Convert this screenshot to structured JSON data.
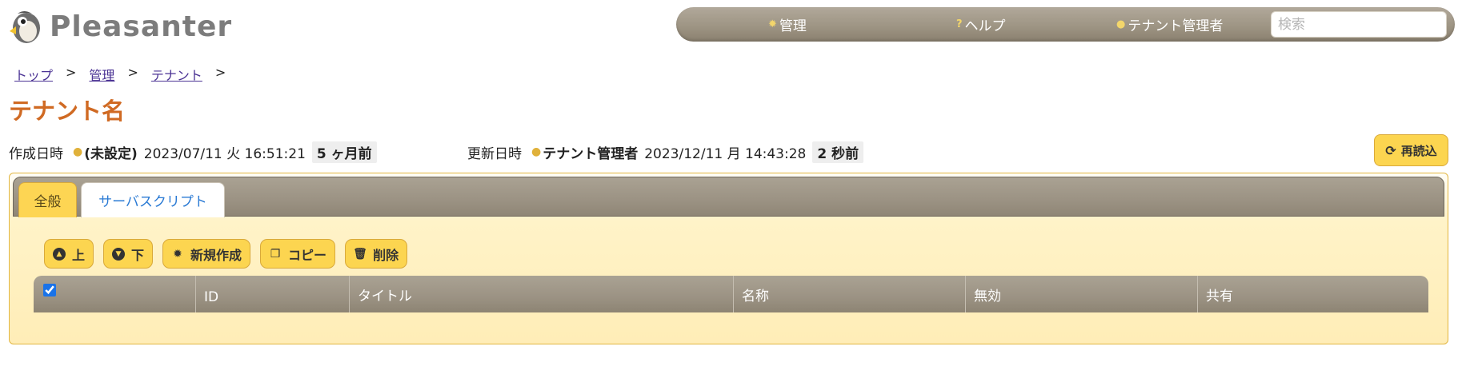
{
  "header": {
    "logo_text": "Pleasanter",
    "nav": {
      "manage": "管理",
      "help": "ヘルプ",
      "user": "テナント管理者"
    },
    "search_placeholder": "検索"
  },
  "breadcrumb": {
    "items": [
      "トップ",
      "管理",
      "テナント"
    ],
    "separator": ">"
  },
  "page_title": "テナント名",
  "record_info": {
    "created_label": "作成日時",
    "created_by": "(未設定)",
    "created_at": "2023/07/11 火 16:51:21",
    "created_relative": "5 ヶ月前",
    "updated_label": "更新日時",
    "updated_by": "テナント管理者",
    "updated_at": "2023/12/11 月 14:43:28",
    "updated_relative": "2 秒前"
  },
  "reload_label": "再読込",
  "tabs": {
    "general": "全般",
    "server_script": "サーバスクリプト"
  },
  "toolbar": {
    "up": "上",
    "down": "下",
    "new": "新規作成",
    "copy": "コピー",
    "delete": "削除"
  },
  "grid": {
    "columns": [
      "ID",
      "タイトル",
      "名称",
      "無効",
      "共有"
    ],
    "select_all_checked": true
  },
  "colors": {
    "accent_yellow": "#fcd550",
    "title_orange": "#d06a23",
    "nav_gray": "#9e9584",
    "link_purple": "#4b3394",
    "active_tab_text": "#2a7ad4"
  }
}
